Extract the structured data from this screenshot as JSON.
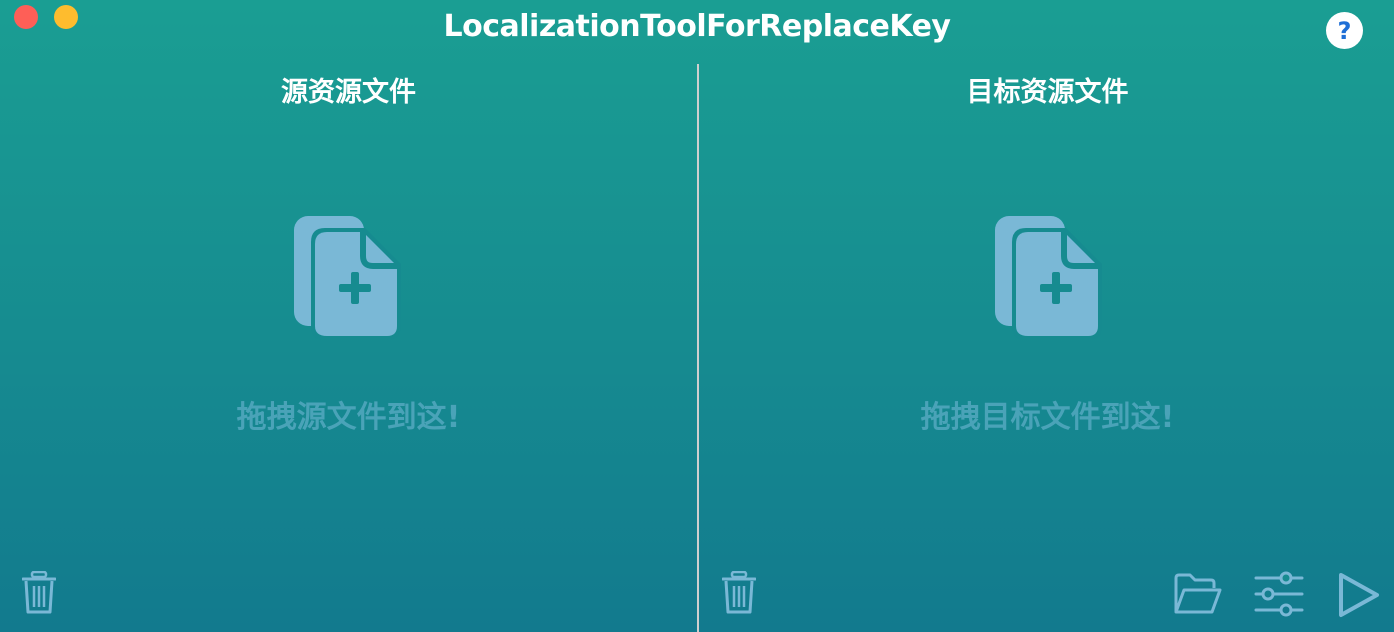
{
  "window": {
    "title": "LocalizationToolForReplaceKey",
    "help_label": "?"
  },
  "source_pane": {
    "title": "源资源文件",
    "drop_hint": "拖拽源文件到这!",
    "icons": {
      "drop": "file-add-icon",
      "delete": "trash-icon"
    }
  },
  "target_pane": {
    "title": "目标资源文件",
    "drop_hint": "拖拽目标文件到这!",
    "icons": {
      "drop": "file-add-icon",
      "delete": "trash-icon"
    }
  },
  "toolbar": {
    "icons": [
      "folder-open-icon",
      "settings-sliders-icon",
      "play-icon"
    ]
  },
  "colors": {
    "icon": "#7ab8d6",
    "hint_text": "#4aa3b8",
    "help_mark": "#1f6fd6",
    "close": "#fe5f57",
    "minimize": "#febc2e"
  }
}
